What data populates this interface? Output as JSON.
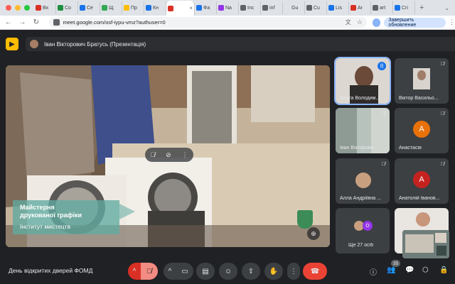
{
  "browser": {
    "tabs": [
      {
        "label": "Вх",
        "color": "#d93025"
      },
      {
        "label": "Co",
        "color": "#1e8e3e"
      },
      {
        "label": "Се",
        "color": "#1a73e8"
      },
      {
        "label": "Щ",
        "color": "#34a853"
      },
      {
        "label": "Пр",
        "color": "#fbbc04"
      },
      {
        "label": "Кн",
        "color": "#1a73e8"
      },
      {
        "label": "",
        "color": "#d93025",
        "active": true
      },
      {
        "label": "Фа",
        "color": "#1a73e8"
      },
      {
        "label": "Na",
        "color": "#9334e6"
      },
      {
        "label": "Inc",
        "color": "#5f6368"
      },
      {
        "label": "inf",
        "color": "#5f6368"
      },
      {
        "label": "Gu",
        "color": "#dfe3e8"
      },
      {
        "label": "Cu",
        "color": "#5f6368"
      },
      {
        "label": "Lis",
        "color": "#1a73e8"
      },
      {
        "label": "Ar",
        "color": "#d93025"
      },
      {
        "label": "art",
        "color": "#5f6368"
      },
      {
        "label": "Cri",
        "color": "#1a73e8"
      }
    ],
    "active_tab_close": "×",
    "new_tab": "+",
    "url": "meet.google.com/osf-iypu-vmz?authuser=0",
    "update_button": "Завершить обновление"
  },
  "meet": {
    "presenter_label": "Іван Вікторович Братусь (Презентація)",
    "caption": {
      "line1": "Майстерня",
      "line2": "друкованої графіки",
      "line3": "Інститут мистецтв"
    },
    "participants": [
      {
        "name": "Ольга Володим...",
        "type": "video",
        "speaking": true
      },
      {
        "name": "Віктор Васильо...",
        "type": "video"
      },
      {
        "name": "Іван Вікторови...",
        "type": "video"
      },
      {
        "name": "Анастасія",
        "type": "letter",
        "letter": "А",
        "color": "#e8710a"
      },
      {
        "name": "Алла Андріївна ...",
        "type": "video"
      },
      {
        "name": "Анатолій Іванов...",
        "type": "letter",
        "letter": "А",
        "color": "#c5221f"
      },
      {
        "name": "Ще 27 осіб",
        "type": "more",
        "letter": "O",
        "color": "#9334e6"
      }
    ],
    "meeting_title": "День відкритих дверей ФОМД",
    "people_count": "35"
  }
}
